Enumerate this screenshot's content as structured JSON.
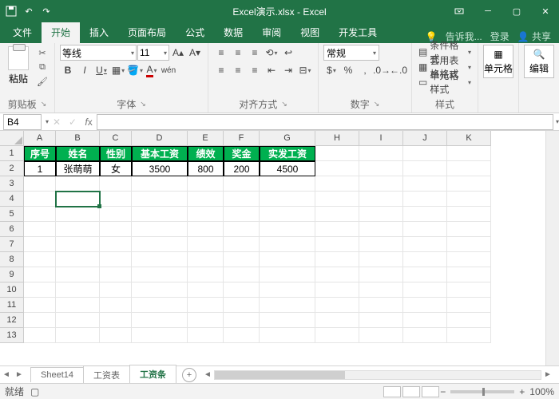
{
  "titlebar": {
    "filename": "Excel演示.xlsx - Excel"
  },
  "tabs": {
    "file": "文件",
    "home": "开始",
    "insert": "插入",
    "layout": "页面布局",
    "formulas": "公式",
    "data": "数据",
    "review": "审阅",
    "view": "视图",
    "dev": "开发工具",
    "tellme": "告诉我...",
    "signin": "登录",
    "share": "共享"
  },
  "ribbon": {
    "clipboard": {
      "label": "剪贴板",
      "paste": "粘贴"
    },
    "font": {
      "label": "字体",
      "name": "等线",
      "size": "11",
      "bold": "B",
      "italic": "I",
      "underline": "U",
      "ruby": "wén"
    },
    "align": {
      "label": "对齐方式"
    },
    "number": {
      "label": "数字",
      "format": "常规"
    },
    "styles": {
      "label": "样式",
      "cond": "条件格式",
      "table": "套用表格格式",
      "cell": "单元格样式"
    },
    "cells": {
      "label": "单元格"
    },
    "editing": {
      "label": "编辑"
    }
  },
  "namebox": "B4",
  "columns": [
    "A",
    "B",
    "C",
    "D",
    "E",
    "F",
    "G",
    "H",
    "I",
    "J",
    "K"
  ],
  "headers": [
    "序号",
    "姓名",
    "性别",
    "基本工资",
    "绩效",
    "奖金",
    "实发工资"
  ],
  "data_row": [
    "1",
    "张萌萌",
    "女",
    "3500",
    "800",
    "200",
    "4500"
  ],
  "sheets": {
    "s1": "Sheet14",
    "s2": "工资表",
    "s3": "工资条"
  },
  "status": {
    "ready": "就绪",
    "rec": "",
    "zoom": "100%"
  },
  "chart_data": null
}
